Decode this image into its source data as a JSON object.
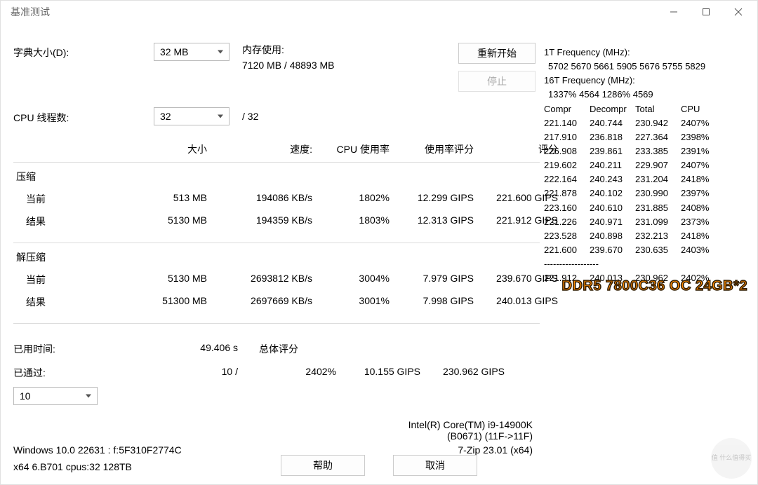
{
  "window": {
    "title": "基准测试"
  },
  "controls": {
    "dict_label": "字典大小(D):",
    "dict_value": "32 MB",
    "threads_label": "CPU 线程数:",
    "threads_value": "32",
    "threads_total": "/ 32",
    "mem_label": "内存使用:",
    "mem_value": "7120 MB / 48893 MB",
    "restart_btn": "重新开始",
    "stop_btn": "停止"
  },
  "headers": {
    "size": "大小",
    "speed": "速度:",
    "cpu_usage": "CPU 使用率",
    "usage_rating": "使用率评分",
    "rating": "评分"
  },
  "compress": {
    "section": "压缩",
    "current_label": "当前",
    "result_label": "结果",
    "current": {
      "size": "513 MB",
      "speed": "194086 KB/s",
      "cpu": "1802%",
      "usage_rating": "12.299 GIPS",
      "rating": "221.600 GIPS"
    },
    "result": {
      "size": "5130 MB",
      "speed": "194359 KB/s",
      "cpu": "1803%",
      "usage_rating": "12.313 GIPS",
      "rating": "221.912 GIPS"
    }
  },
  "decompress": {
    "section": "解压缩",
    "current_label": "当前",
    "result_label": "结果",
    "current": {
      "size": "5130 MB",
      "speed": "2693812 KB/s",
      "cpu": "3004%",
      "usage_rating": "7.979 GIPS",
      "rating": "239.670 GIPS"
    },
    "result": {
      "size": "51300 MB",
      "speed": "2697669 KB/s",
      "cpu": "3001%",
      "usage_rating": "7.998 GIPS",
      "rating": "240.013 GIPS"
    }
  },
  "summary": {
    "elapsed_label": "已用时间:",
    "elapsed_value": "49.406 s",
    "passed_label": "已通过:",
    "passed_value": "10 /",
    "overall_label": "总体评分",
    "overall_cpu": "2402%",
    "overall_usage_rating": "10.155 GIPS",
    "overall_rating": "230.962 GIPS",
    "passes_select": "10"
  },
  "sysinfo": {
    "cpu_line1": "Intel(R) Core(TM) i9-14900K",
    "cpu_line2": "(B0671) (11F->11F)",
    "os": "Windows 10.0 22631 :  f:5F310F2774C",
    "app": "7-Zip 23.01 (x64)",
    "arch": "x64 6.B701 cpus:32 128TB"
  },
  "footer": {
    "help": "帮助",
    "cancel": "取消"
  },
  "freq": {
    "t1_label": "1T Frequency (MHz):",
    "t1_values": "5702 5670 5661 5905 5676 5755 5829",
    "t16_label": "16T Frequency (MHz):",
    "t16_values": "1337% 4564 1286% 4569"
  },
  "stats": {
    "head": {
      "c1": "Compr",
      "c2": "Decompr",
      "c3": "Total",
      "c4": "CPU"
    },
    "rows": [
      {
        "c1": "221.140",
        "c2": "240.744",
        "c3": "230.942",
        "c4": "2407%"
      },
      {
        "c1": "217.910",
        "c2": "236.818",
        "c3": "227.364",
        "c4": "2398%"
      },
      {
        "c1": "226.908",
        "c2": "239.861",
        "c3": "233.385",
        "c4": "2391%"
      },
      {
        "c1": "219.602",
        "c2": "240.211",
        "c3": "229.907",
        "c4": "2407%"
      },
      {
        "c1": "222.164",
        "c2": "240.243",
        "c3": "231.204",
        "c4": "2418%"
      },
      {
        "c1": "221.878",
        "c2": "240.102",
        "c3": "230.990",
        "c4": "2397%"
      },
      {
        "c1": "223.160",
        "c2": "240.610",
        "c3": "231.885",
        "c4": "2408%"
      },
      {
        "c1": "221.226",
        "c2": "240.971",
        "c3": "231.099",
        "c4": "2373%"
      },
      {
        "c1": "223.528",
        "c2": "240.898",
        "c3": "232.213",
        "c4": "2418%"
      },
      {
        "c1": "221.600",
        "c2": "239.670",
        "c3": "230.635",
        "c4": "2403%"
      }
    ],
    "divider": "------------------",
    "final": {
      "c1": "221.912",
      "c2": "240.013",
      "c3": "230.962",
      "c4": "2402%"
    }
  },
  "overlay_text": "DDR5 7800C36 OC 24GB*2",
  "watermark": "值 什么值得买"
}
